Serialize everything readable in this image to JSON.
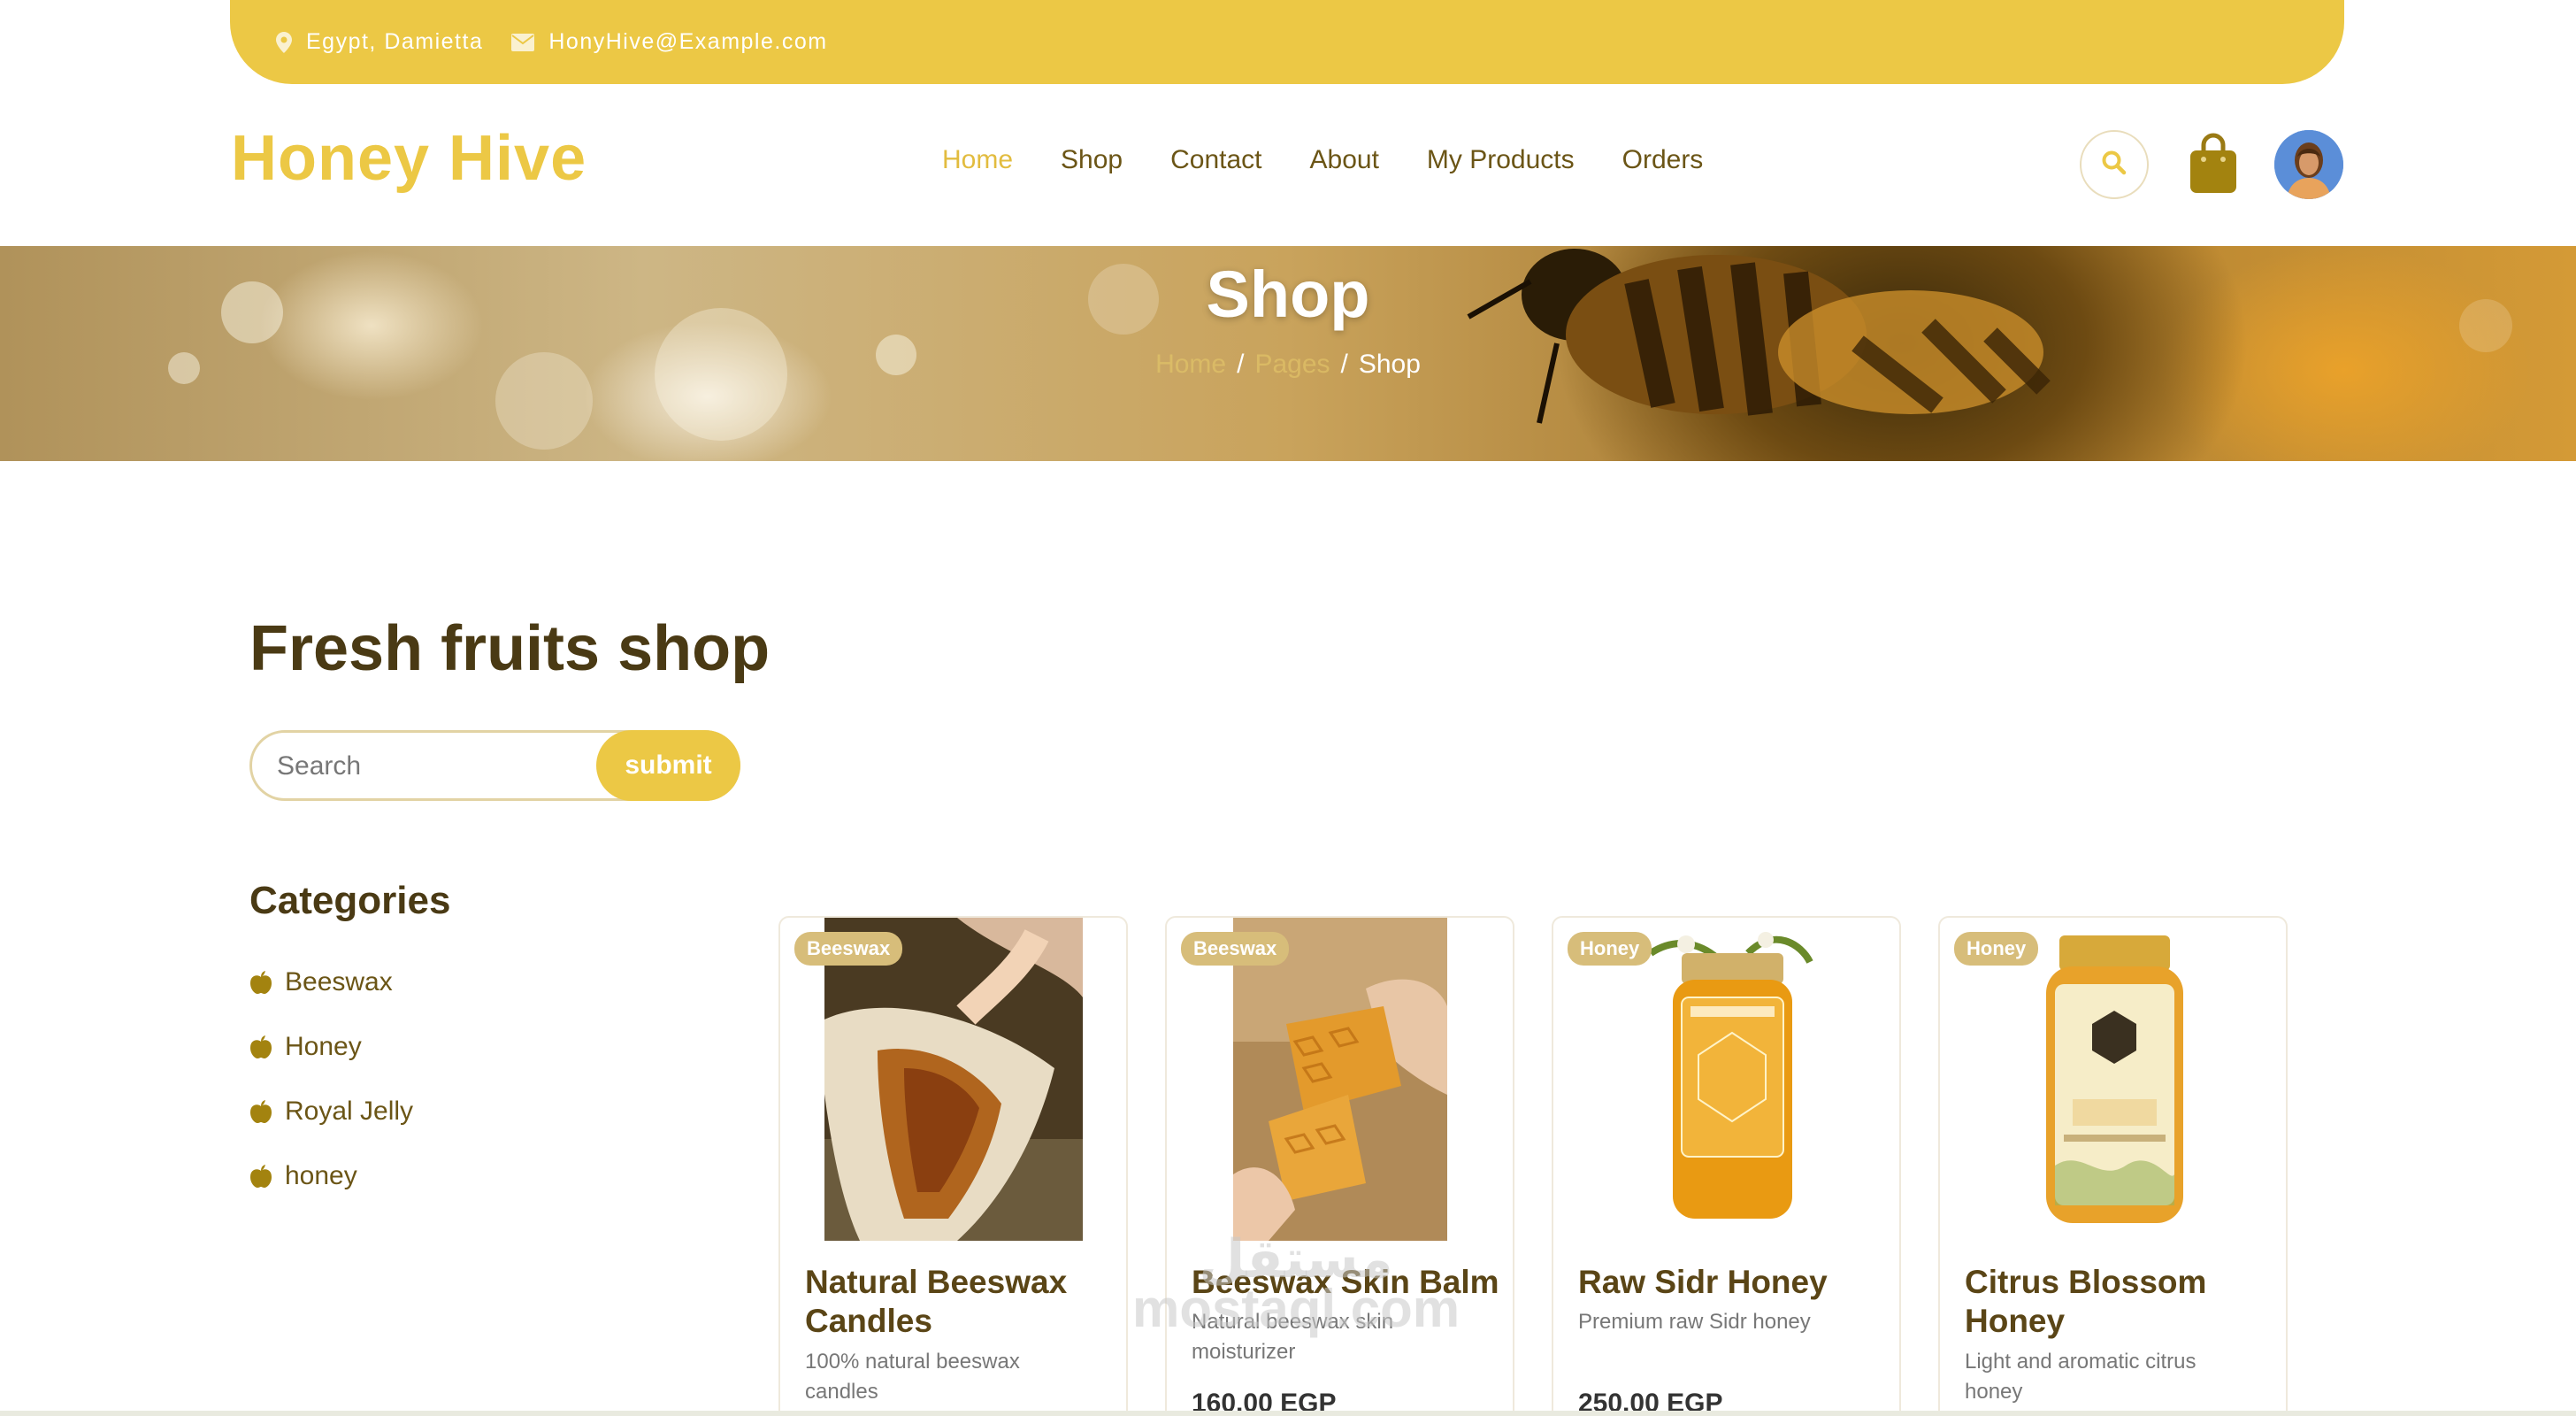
{
  "topbar": {
    "location": "Egypt, Damietta",
    "email": "HonyHive@Example.com"
  },
  "brand": "Honey Hive",
  "nav": [
    {
      "label": "Home",
      "active": true
    },
    {
      "label": "Shop"
    },
    {
      "label": "Contact"
    },
    {
      "label": "About"
    },
    {
      "label": "My Products"
    },
    {
      "label": "Orders"
    }
  ],
  "header_icons": [
    "search-icon",
    "shopping-bag-icon",
    "user-avatar"
  ],
  "banner": {
    "title": "Shop",
    "breadcrumb": [
      "Home",
      "Pages",
      "Shop"
    ]
  },
  "main": {
    "heading": "Fresh fruits shop",
    "search": {
      "placeholder": "Search",
      "submit_label": "submit"
    }
  },
  "categories": {
    "title": "Categories",
    "items": [
      "Beeswax",
      "Honey",
      "Royal Jelly",
      "honey"
    ]
  },
  "products": [
    {
      "tag": "Beeswax",
      "name": "Natural Beeswax Candles",
      "description": "100% natural beeswax candles",
      "price": ""
    },
    {
      "tag": "Beeswax",
      "name": "Beeswax Skin Balm",
      "description": "Natural beeswax skin moisturizer",
      "price": "160.00 EGP"
    },
    {
      "tag": "Honey",
      "name": "Raw Sidr Honey",
      "description": "Premium raw Sidr honey",
      "price": "250.00 EGP"
    },
    {
      "tag": "Honey",
      "name": "Citrus Blossom Honey",
      "description": "Light and aromatic citrus honey",
      "price": ""
    }
  ],
  "watermark": {
    "line1": "مستقل",
    "line2": "mostaql.com"
  },
  "colors": {
    "accent": "#ecc845",
    "brand_text": "#4a3a14",
    "nav_text": "#6b5516",
    "tag": "#d7bd7a"
  }
}
